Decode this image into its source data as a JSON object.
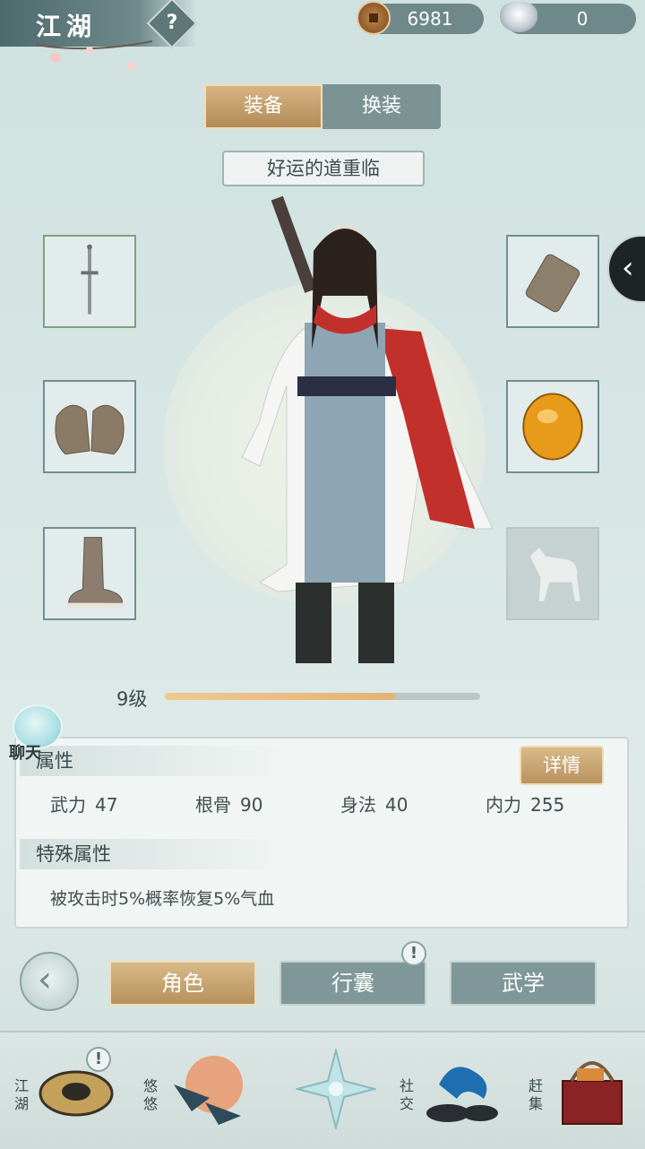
{
  "header": {
    "title": "江湖",
    "help_icon": "question-diamond-icon",
    "currencies": [
      {
        "name": "copper-coin",
        "icon": "copper-coin-icon",
        "value": "6981"
      },
      {
        "name": "silver-ingot",
        "icon": "silver-ingot-icon",
        "value": "0"
      }
    ]
  },
  "tabs": {
    "equip": "装备",
    "outfit": "换装",
    "active": "equip"
  },
  "character": {
    "name": "好运的道重临",
    "level_label": "9级",
    "level_progress": 0.73
  },
  "equipment": {
    "left": [
      {
        "slot": "weapon",
        "icon": "sword-icon"
      },
      {
        "slot": "armor",
        "icon": "shoulder-armor-icon"
      },
      {
        "slot": "boots",
        "icon": "boots-icon"
      }
    ],
    "right": [
      {
        "slot": "bracer",
        "icon": "bracer-icon"
      },
      {
        "slot": "accessory",
        "icon": "amber-gem-icon"
      },
      {
        "slot": "mount",
        "icon": "horse-icon",
        "empty": true
      }
    ]
  },
  "chat": {
    "label": "聊天"
  },
  "attributes": {
    "heading": "属性",
    "detail_button": "详情",
    "stats": [
      {
        "label": "武力",
        "value": "47"
      },
      {
        "label": "根骨",
        "value": "90"
      },
      {
        "label": "身法",
        "value": "40"
      },
      {
        "label": "内力",
        "value": "255"
      }
    ],
    "special_heading": "特殊属性",
    "special_text": "被攻击时5%概率恢复5%气血"
  },
  "nav": {
    "back_icon": "back-arrow-icon",
    "buttons": [
      {
        "label": "角色",
        "active": true
      },
      {
        "label": "行囊",
        "active": false,
        "alert": "!"
      },
      {
        "label": "武学",
        "active": false
      }
    ]
  },
  "dock": [
    {
      "label": "江湖",
      "icon": "jianghu-hat-icon",
      "alert": "!"
    },
    {
      "label": "悠悠",
      "icon": "swallow-bird-icon"
    },
    {
      "label": "",
      "icon": "compass-star-icon"
    },
    {
      "label": "社交",
      "icon": "wave-bowl-icon"
    },
    {
      "label": "赶集",
      "icon": "market-basket-icon"
    }
  ],
  "colors": {
    "accent_gold": "#c6a270",
    "slate": "#7f9799",
    "bg": "#d7e6e4"
  }
}
